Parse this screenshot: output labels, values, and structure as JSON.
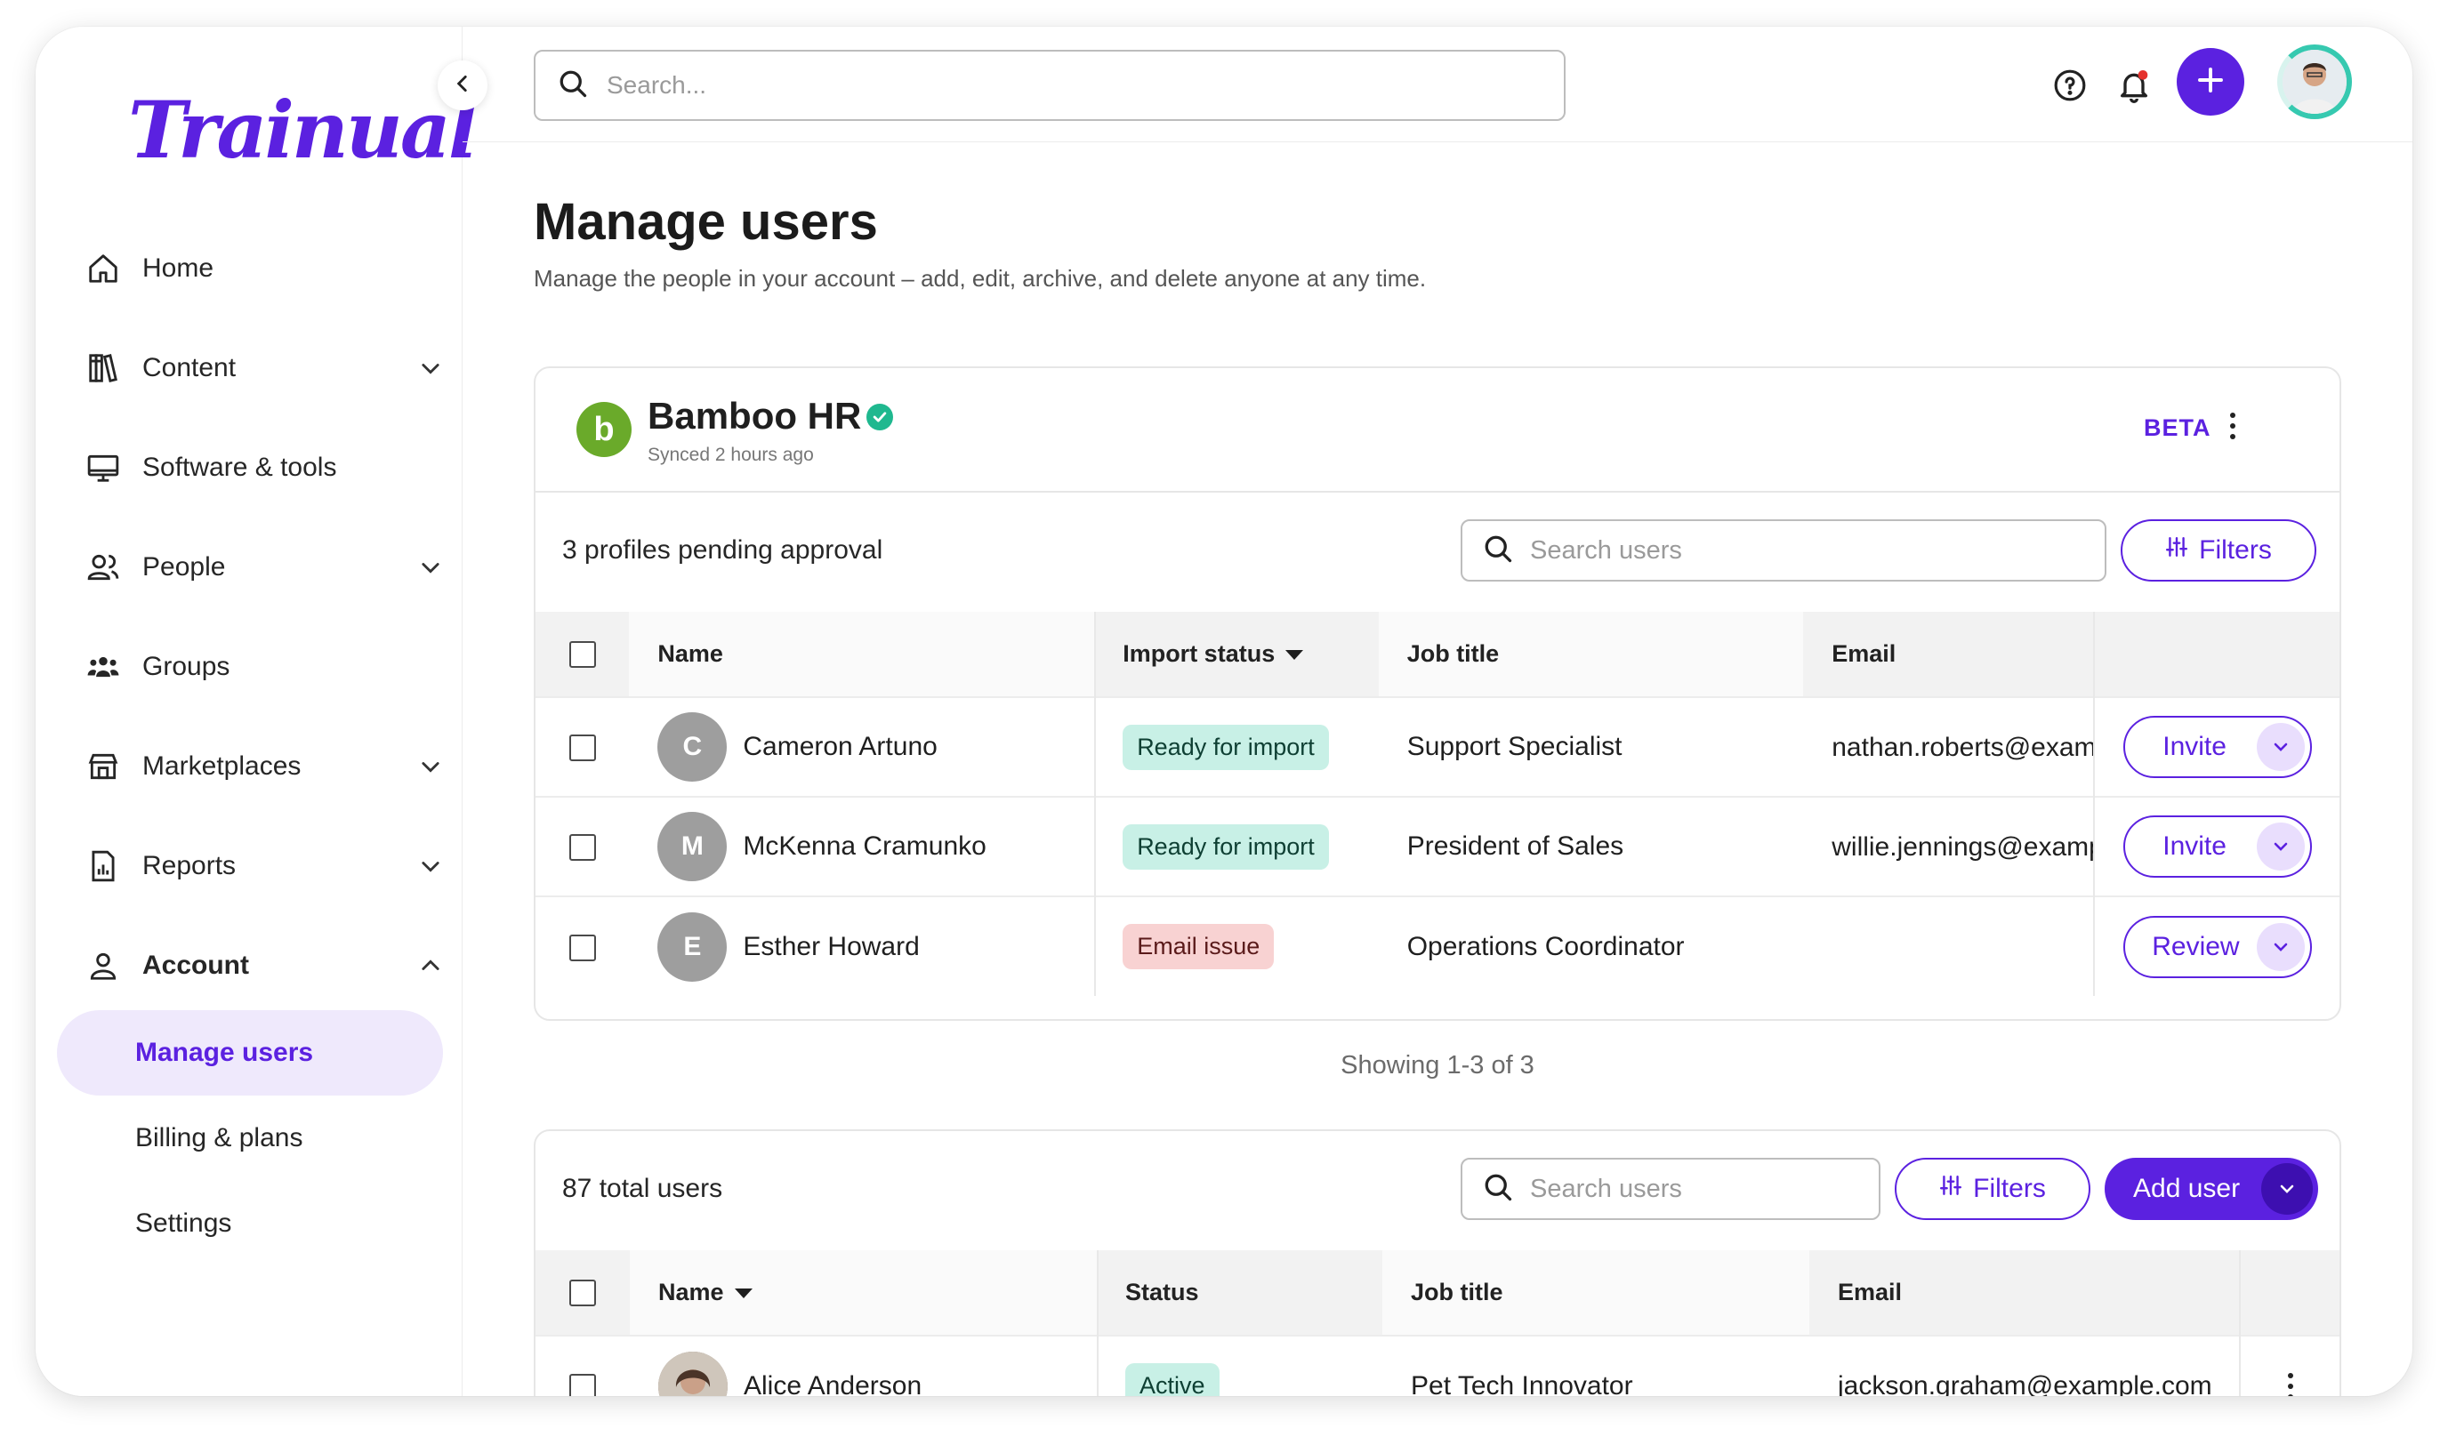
{
  "app": {
    "logo_text": "Trainual"
  },
  "sidebar": {
    "items": [
      {
        "label": "Home",
        "icon": "home-icon",
        "expandable": false
      },
      {
        "label": "Content",
        "icon": "books-icon",
        "expandable": true
      },
      {
        "label": "Software & tools",
        "icon": "monitor-icon",
        "expandable": false
      },
      {
        "label": "People",
        "icon": "people-icon",
        "expandable": true
      },
      {
        "label": "Groups",
        "icon": "groups-icon",
        "expandable": false
      },
      {
        "label": "Marketplaces",
        "icon": "store-icon",
        "expandable": true
      },
      {
        "label": "Reports",
        "icon": "report-icon",
        "expandable": true
      },
      {
        "label": "Account",
        "icon": "user-icon",
        "expandable": true,
        "expanded": true
      }
    ],
    "account_sub": [
      {
        "label": "Manage users",
        "active": true
      },
      {
        "label": "Billing & plans",
        "active": false
      },
      {
        "label": "Settings",
        "active": false
      }
    ]
  },
  "topbar": {
    "search_placeholder": "Search..."
  },
  "page": {
    "title": "Manage users",
    "subtitle": "Manage the people in your account – add, edit, archive, and delete anyone at any time."
  },
  "integration": {
    "logo_letter": "b",
    "name": "Bamboo HR",
    "synced": "Synced 2 hours ago",
    "beta": "BETA",
    "pending_text": "3 profiles pending approval",
    "search_placeholder": "Search users",
    "filters_label": "Filters",
    "columns": {
      "name": "Name",
      "status": "Import status",
      "job": "Job title",
      "email": "Email"
    },
    "rows": [
      {
        "initial": "C",
        "name": "Cameron Artuno",
        "status": "Ready for import",
        "status_type": "ready",
        "job": "Support Specialist",
        "email": "nathan.roberts@example.com",
        "action": "Invite"
      },
      {
        "initial": "M",
        "name": "McKenna Cramunko",
        "status": "Ready for import",
        "status_type": "ready",
        "job": "President of Sales",
        "email": "willie.jennings@example.com",
        "action": "Invite"
      },
      {
        "initial": "E",
        "name": "Esther Howard",
        "status": "Email issue",
        "status_type": "issue",
        "job": "Operations Coordinator",
        "email": "",
        "action": "Review"
      }
    ],
    "showing": "Showing  1-3 of 3"
  },
  "users": {
    "total_text": "87 total users",
    "search_placeholder": "Search users",
    "filters_label": "Filters",
    "add_label": "Add user",
    "columns": {
      "name": "Name",
      "status": "Status",
      "job": "Job title",
      "email": "Email"
    },
    "rows": [
      {
        "name": "Alice Anderson",
        "status": "Active",
        "job": "Pet Tech Innovator",
        "email": "jackson.graham@example.com"
      }
    ]
  },
  "colors": {
    "brand": "#5b21e0",
    "brand_light": "#efe9fc",
    "ready_bg": "#c8f0e6",
    "issue_bg": "#f8d2d2",
    "bamboo": "#6aaa2a",
    "verified": "#1fb88f"
  }
}
